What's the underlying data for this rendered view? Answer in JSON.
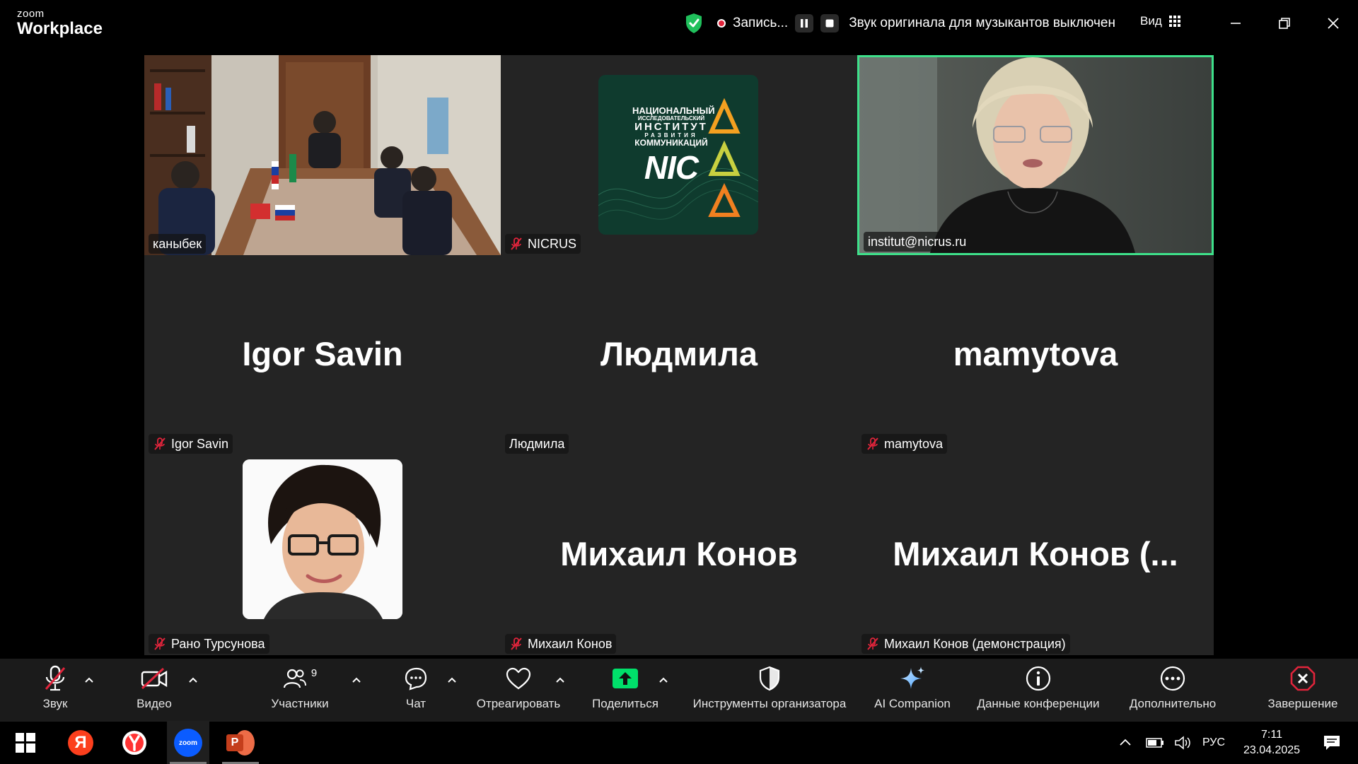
{
  "app": {
    "brand_top": "zoom",
    "brand_bottom": "Workplace"
  },
  "topbar": {
    "recording_label": "Запись...",
    "music_notice": "Звук оригинала для музыкантов выключен",
    "view_label": "Вид"
  },
  "tiles": [
    {
      "name": "каныбек",
      "muted": false,
      "type": "video"
    },
    {
      "name": "NICRUS",
      "muted": true,
      "type": "logo",
      "logo_lines": [
        "НАЦИОНАЛЬНЫЙ",
        "ИССЛЕДОВАТЕЛЬСКИЙ",
        "ИНСТИТУТ",
        "РАЗВИТИЯ",
        "КОММУНИКАЦИЙ"
      ],
      "logo_mark": "NIC"
    },
    {
      "name": "institut@nicrus.ru",
      "muted": false,
      "type": "video",
      "active": true
    },
    {
      "name": "Igor Savin",
      "display": "Igor Savin",
      "muted": true,
      "type": "name"
    },
    {
      "name": "Людмила",
      "display": "Людмила",
      "muted": false,
      "type": "name"
    },
    {
      "name": "mamytova",
      "display": "mamytova",
      "muted": true,
      "type": "name"
    },
    {
      "name": "Рано Турсунова",
      "muted": true,
      "type": "photo"
    },
    {
      "name": "Михаил Конов",
      "display": "Михаил Конов",
      "muted": true,
      "type": "name"
    },
    {
      "name": "Михаил Конов (демонстрация)",
      "display": "Михаил Конов (...",
      "muted": true,
      "type": "name"
    }
  ],
  "toolbar": {
    "audio": "Звук",
    "video": "Видео",
    "participants": "Участники",
    "participants_count": "9",
    "chat": "Чат",
    "react": "Отреагировать",
    "share": "Поделиться",
    "host_tools": "Инструменты организатора",
    "ai": "AI Companion",
    "info": "Данные конференции",
    "more": "Дополнительно",
    "end": "Завершение"
  },
  "taskbar": {
    "lang": "РУС",
    "time": "7:11",
    "date": "23.04.2025",
    "yandex_letter": "Я",
    "zoom_label": "zoom",
    "ppt_letter": "P"
  },
  "colors": {
    "accent_green": "#3ee08a",
    "share_green": "#00e06a",
    "end_red": "#e0243b",
    "tile_bg": "#242424"
  }
}
